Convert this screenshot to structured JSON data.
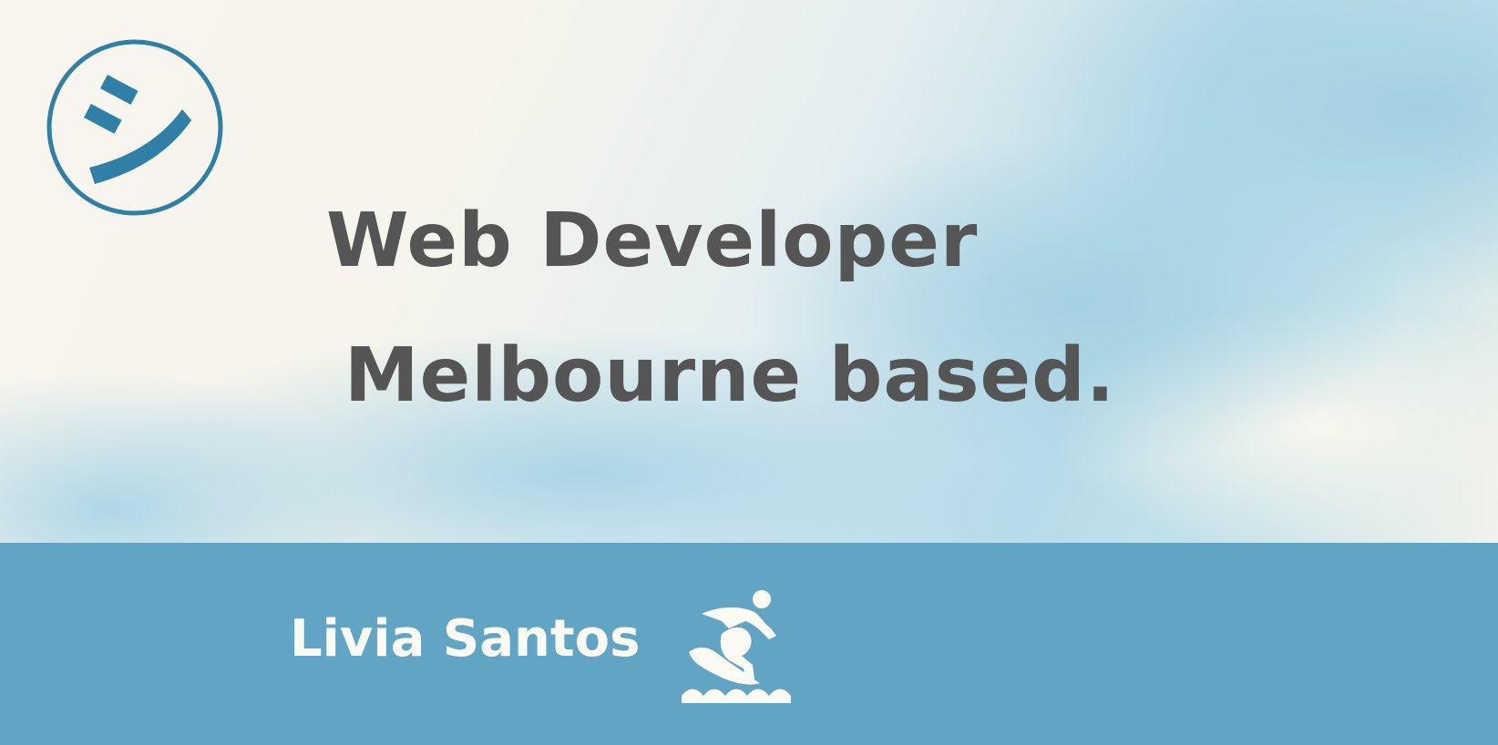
{
  "hero": {
    "logo_icon": "smiley-circle-icon",
    "title_line1": "Web Developer",
    "title_line2": "Melbourne based."
  },
  "footer": {
    "name": "Livia Santos",
    "icon": "surfer-icon"
  },
  "colors": {
    "accent": "#2f7fa6",
    "footer_bg": "#62a4c3",
    "heading": "#555555",
    "footer_text": "#fbfaf3"
  }
}
